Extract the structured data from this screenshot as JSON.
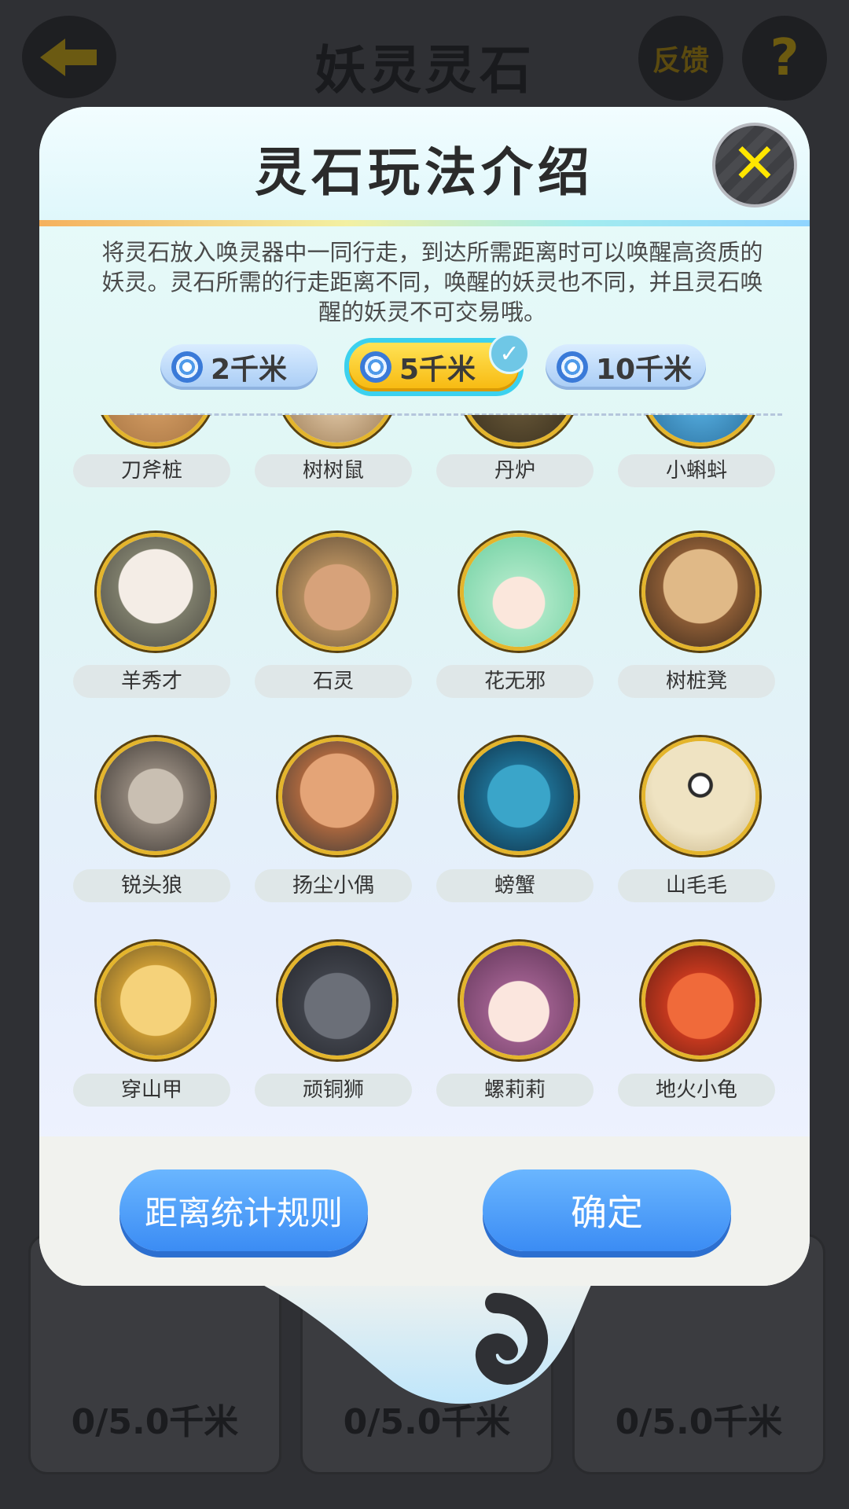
{
  "background_page": {
    "title": "妖灵灵石",
    "feedback_label": "反馈",
    "help_label": "?",
    "progress_items": [
      "0/5.0千米",
      "0/5.0千米",
      "0/5.0千米"
    ]
  },
  "modal": {
    "title": "灵石玩法介绍",
    "close_label": "✕",
    "description": "将灵石放入唤灵器中一同行走，到达所需距离时可以唤醒高资质的妖灵。灵石所需的行走距离不同，唤醒的妖灵也不同，并且灵石唤醒的妖灵不可交易哦。",
    "tabs": [
      {
        "label": "2千米",
        "selected": false
      },
      {
        "label": "5千米",
        "selected": true
      },
      {
        "label": "10千米",
        "selected": false
      }
    ],
    "selected_check": "✓",
    "creatures": [
      {
        "name": "刀斧桩",
        "icon": "stump-creature-icon"
      },
      {
        "name": "树树鼠",
        "icon": "tree-mouse-icon"
      },
      {
        "name": "丹炉",
        "icon": "furnace-icon"
      },
      {
        "name": "小蝌蚪",
        "icon": "tadpole-icon"
      },
      {
        "name": "羊秀才",
        "icon": "goat-scholar-icon"
      },
      {
        "name": "石灵",
        "icon": "stone-spirit-icon"
      },
      {
        "name": "花无邪",
        "icon": "flower-girl-icon"
      },
      {
        "name": "树桩凳",
        "icon": "stump-stool-icon"
      },
      {
        "name": "锐头狼",
        "icon": "wolf-icon"
      },
      {
        "name": "扬尘小偶",
        "icon": "dust-doll-icon"
      },
      {
        "name": "螃蟹",
        "icon": "crab-icon"
      },
      {
        "name": "山毛毛",
        "icon": "furball-icon"
      },
      {
        "name": "穿山甲",
        "icon": "pangolin-icon"
      },
      {
        "name": "顽铜狮",
        "icon": "bronze-lion-icon"
      },
      {
        "name": "螺莉莉",
        "icon": "snail-girl-icon"
      },
      {
        "name": "地火小龟",
        "icon": "fire-turtle-icon"
      }
    ],
    "buttons": {
      "rules_label": "距离统计规则",
      "confirm_label": "确定"
    }
  },
  "colors": {
    "accent_blue": "#3b8cf4",
    "tab_selected": "#f7b80e",
    "avatar_ring": "#e4b52c",
    "close_x": "#ffe600"
  }
}
